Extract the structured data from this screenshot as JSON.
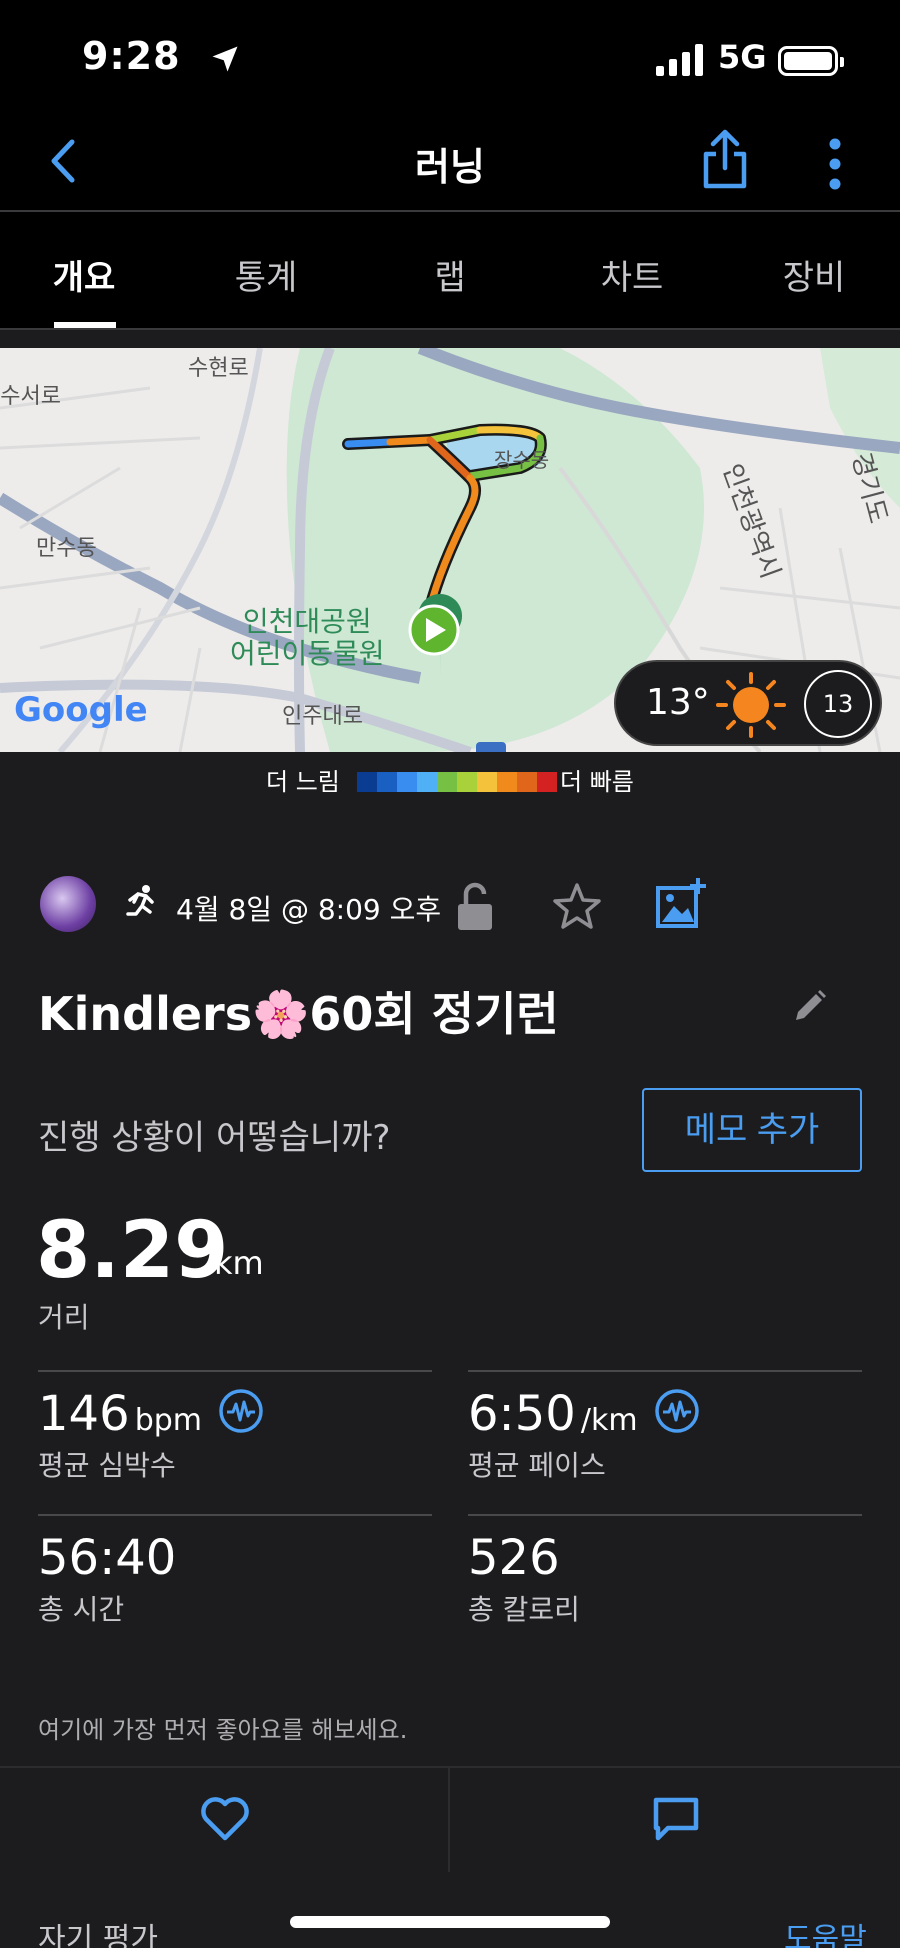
{
  "status_bar": {
    "time": "9:28",
    "network": "5G",
    "icons": [
      "location-arrow-icon",
      "signal-icon",
      "battery-icon"
    ]
  },
  "nav": {
    "title": "러닝",
    "icons": [
      "back-icon",
      "share-icon",
      "more-icon"
    ]
  },
  "tabs": [
    {
      "label": "개요",
      "active": true
    },
    {
      "label": "통계",
      "active": false
    },
    {
      "label": "랩",
      "active": false
    },
    {
      "label": "차트",
      "active": false
    },
    {
      "label": "장비",
      "active": false
    }
  ],
  "map": {
    "labels": {
      "suhyeon": "수현로",
      "suseo": "남수서로",
      "mansu": "만수동",
      "jangsu": "장수동",
      "park1": "인천대공원",
      "park2": "어린이동물원",
      "inju": "인주대로",
      "incheon": "인천광역시",
      "gyeonggi": "경기도",
      "google": "Google"
    },
    "weather": {
      "temperature": "13°",
      "wind": "13",
      "icon": "sun-icon"
    }
  },
  "legend": {
    "slow": "더 느림",
    "fast": "더 빠름",
    "colors": [
      "#0a3d91",
      "#1a5fc2",
      "#3a8df0",
      "#4fb0f5",
      "#76c043",
      "#a8d13a",
      "#f5c33b",
      "#f08a1c",
      "#e0661b",
      "#d42222"
    ]
  },
  "activity": {
    "date": "4월 8일 @ 8:09 오후",
    "title": "Kindlers🌸60회 정기런",
    "question": "진행 상황이 어떻습니까?",
    "memo_button": "메모 추가"
  },
  "stats": {
    "distance": {
      "value": "8.29",
      "unit": "km",
      "label": "거리"
    },
    "heart_rate": {
      "value": "146",
      "unit": "bpm",
      "label": "평균 심박수"
    },
    "pace": {
      "value": "6:50",
      "unit": "/km",
      "label": "평균 페이스"
    },
    "time": {
      "value": "56:40",
      "label": "총 시간"
    },
    "calories": {
      "value": "526",
      "label": "총 칼로리"
    }
  },
  "like_prompt": "여기에 가장 먼저 좋아요를 해보세요.",
  "footer": {
    "self_eval": "자기 평가",
    "help": "도움말"
  },
  "accent_color": "#4a9df0"
}
